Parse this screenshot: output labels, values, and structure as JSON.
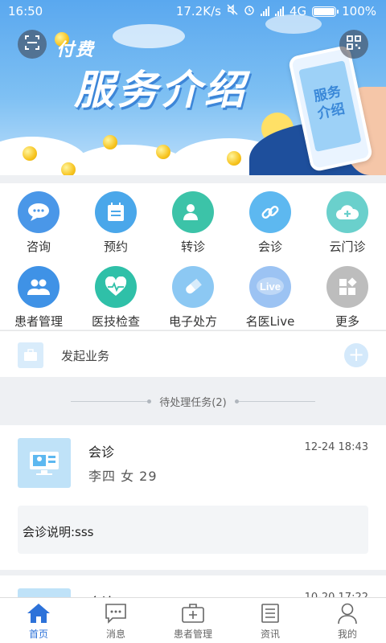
{
  "status_bar": {
    "time": "16:50",
    "network_speed": "17.2K/s",
    "network_type": "4G",
    "battery": "100%"
  },
  "banner": {
    "subtitle": "付费",
    "title": "服务介绍",
    "phone_text_line1": "服务",
    "phone_text_line2": "介绍"
  },
  "services": [
    {
      "label": "咨询",
      "icon": "chat-bubble-icon",
      "color": "#4a97e8"
    },
    {
      "label": "预约",
      "icon": "calendar-icon",
      "color": "#4aa7ea"
    },
    {
      "label": "转诊",
      "icon": "transfer-user-icon",
      "color": "#3cc3a8"
    },
    {
      "label": "会诊",
      "icon": "link-icon",
      "color": "#5db8f0"
    },
    {
      "label": "云门诊",
      "icon": "cloud-plus-icon",
      "color": "#6ad0cc"
    },
    {
      "label": "患者管理",
      "icon": "patients-icon",
      "color": "#3f92e6"
    },
    {
      "label": "医技检查",
      "icon": "heart-pulse-icon",
      "color": "#2fc0a8"
    },
    {
      "label": "电子处方",
      "icon": "pill-icon",
      "color": "#8cc8f3"
    },
    {
      "label": "名医Live",
      "icon": "live-icon",
      "color": "#9cc3f3"
    },
    {
      "label": "更多",
      "icon": "more-grid-icon",
      "color": "#bdbdbd"
    }
  ],
  "initiate": {
    "label": "发起业务"
  },
  "pending": {
    "label": "待处理任务(2)"
  },
  "tasks": [
    {
      "title": "会诊",
      "time": "12-24 18:43",
      "patient": "李四  女  29",
      "note": "会诊说明:sss"
    },
    {
      "title": "会诊",
      "time": "10-20 17:22"
    }
  ],
  "nav": [
    {
      "label": "首页",
      "icon": "home-icon",
      "active": true
    },
    {
      "label": "消息",
      "icon": "message-icon"
    },
    {
      "label": "患者管理",
      "icon": "medical-kit-icon"
    },
    {
      "label": "资讯",
      "icon": "news-icon"
    },
    {
      "label": "我的",
      "icon": "profile-icon"
    }
  ]
}
